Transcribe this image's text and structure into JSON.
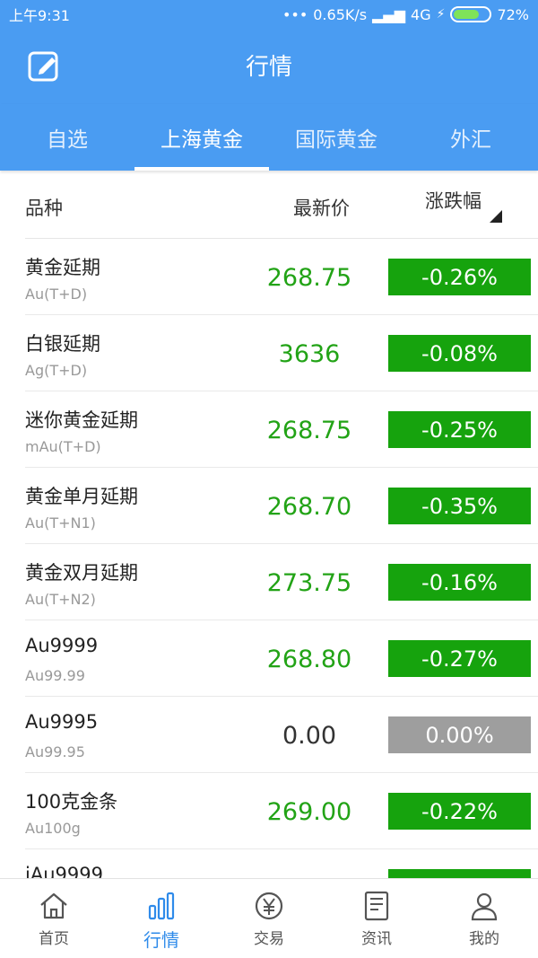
{
  "status": {
    "time": "上午9:31",
    "dots": "•••",
    "speed": "0.65K/s",
    "network": "4G",
    "battery": "72%",
    "battery_level": 0.72
  },
  "header": {
    "title": "行情"
  },
  "tabs": [
    {
      "label": "自选",
      "active": false
    },
    {
      "label": "上海黄金",
      "active": true
    },
    {
      "label": "国际黄金",
      "active": false
    },
    {
      "label": "外汇",
      "active": false
    }
  ],
  "table": {
    "col_name": "品种",
    "col_price": "最新价",
    "col_change": "涨跌幅",
    "rows": [
      {
        "name": "黄金延期",
        "code": "Au(T+D)",
        "price": "268.75",
        "change": "-0.26%"
      },
      {
        "name": "白银延期",
        "code": "Ag(T+D)",
        "price": "3636",
        "change": "-0.08%"
      },
      {
        "name": "迷你黄金延期",
        "code": "mAu(T+D)",
        "price": "268.75",
        "change": "-0.25%"
      },
      {
        "name": "黄金单月延期",
        "code": "Au(T+N1)",
        "price": "268.70",
        "change": "-0.35%"
      },
      {
        "name": "黄金双月延期",
        "code": "Au(T+N2)",
        "price": "273.75",
        "change": "-0.16%"
      },
      {
        "name": "Au9999",
        "code": "Au99.99",
        "price": "268.80",
        "change": "-0.27%"
      },
      {
        "name": "Au9995",
        "code": "Au99.95",
        "price": "0.00",
        "change": "0.00%",
        "flat": true
      },
      {
        "name": "100克金条",
        "code": "Au100g",
        "price": "269.00",
        "change": "-0.22%"
      },
      {
        "name": "iAu9999",
        "code": "",
        "price": "",
        "change": ""
      }
    ]
  },
  "nav": [
    {
      "label": "首页",
      "icon": "home-icon"
    },
    {
      "label": "行情",
      "icon": "chart-icon",
      "active": true
    },
    {
      "label": "交易",
      "icon": "yen-icon"
    },
    {
      "label": "资讯",
      "icon": "news-icon"
    },
    {
      "label": "我的",
      "icon": "user-icon"
    }
  ],
  "colors": {
    "primary": "#4a9cf2",
    "down": "#16a30d",
    "flat": "#9e9e9e",
    "nav_active": "#2f8bea"
  }
}
